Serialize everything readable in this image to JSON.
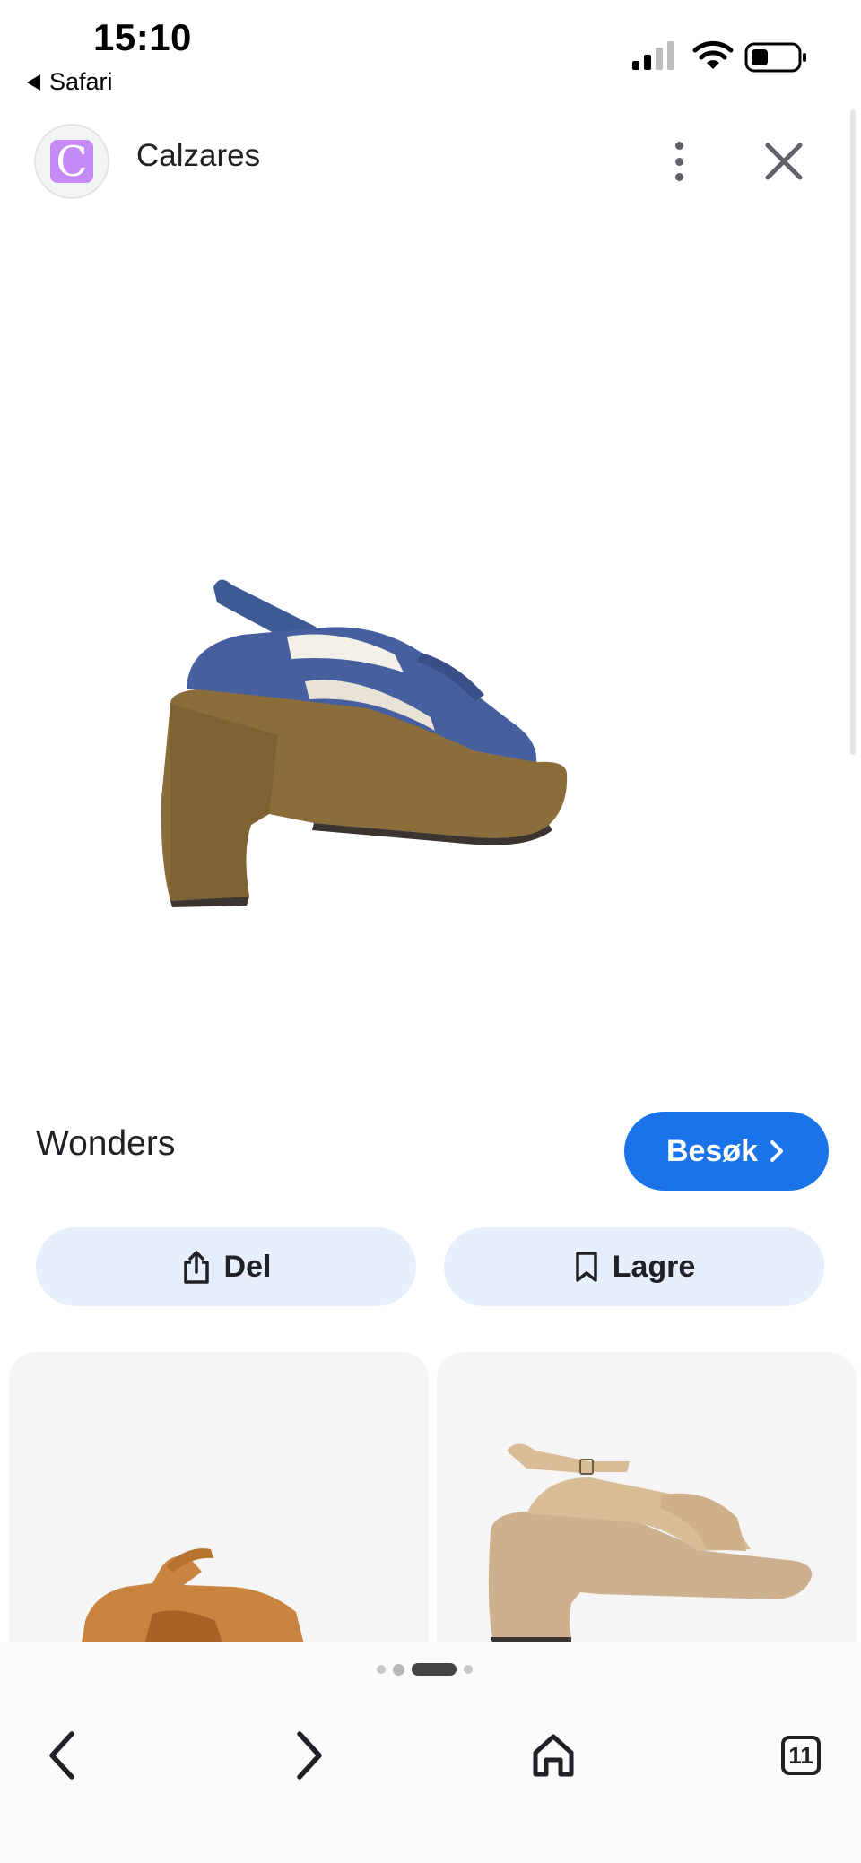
{
  "status_bar": {
    "time": "15:10",
    "back_app": "Safari"
  },
  "header": {
    "site_name": "Calzares",
    "logo_letter": "C"
  },
  "product": {
    "name": "Wonders",
    "visit_label": "Besøk"
  },
  "actions": {
    "share_label": "Del",
    "save_label": "Lagre"
  },
  "nav": {
    "tab_count": "11"
  },
  "colors": {
    "accent": "#1a73e8",
    "pill_bg": "#e8effc",
    "logo_bg": "#c58af6"
  },
  "icons": [
    "signal-icon",
    "wifi-icon",
    "battery-icon",
    "more-vert-icon",
    "close-icon",
    "chevron-right-icon",
    "share-icon",
    "bookmark-icon",
    "back-icon",
    "forward-icon",
    "home-icon",
    "tabs-icon"
  ]
}
